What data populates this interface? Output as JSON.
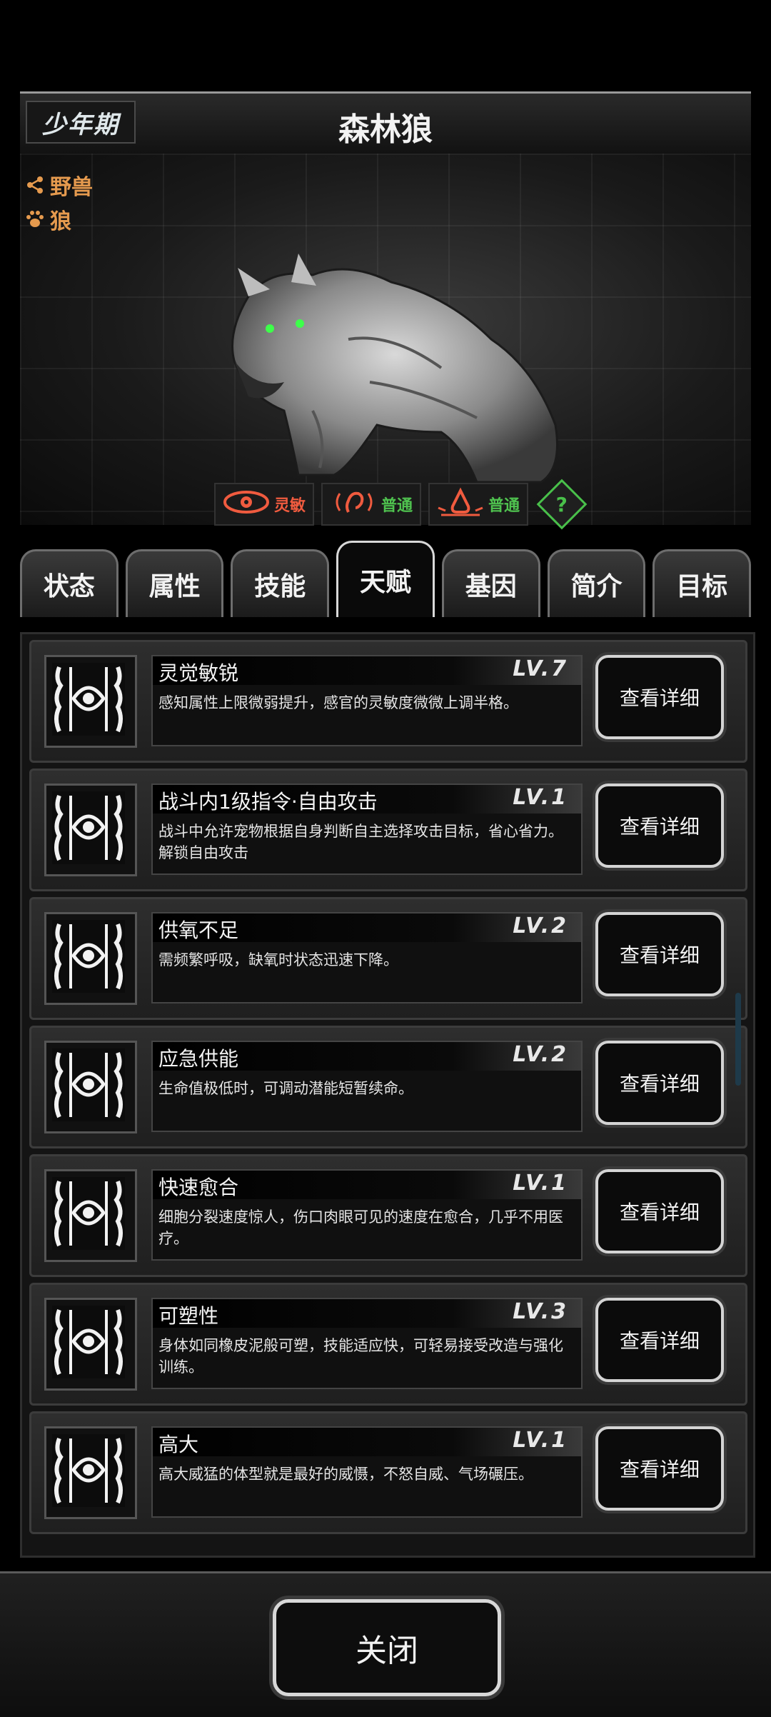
{
  "header": {
    "stage": "少年期",
    "title": "森林狼"
  },
  "tags": [
    {
      "icon": "share-icon",
      "label": "野兽"
    },
    {
      "icon": "paw-icon",
      "label": "狼"
    }
  ],
  "senses": [
    {
      "icon": "eye-icon",
      "label": "灵敏",
      "color": "#f05b3f"
    },
    {
      "icon": "ear-icon",
      "label": "普通",
      "color": "#4fc24f"
    },
    {
      "icon": "nose-icon",
      "label": "普通",
      "color": "#4fc24f"
    }
  ],
  "help_label": "?",
  "tabs": [
    "状态",
    "属性",
    "技能",
    "天赋",
    "基因",
    "简介",
    "目标"
  ],
  "active_tab": "天赋",
  "talents": [
    {
      "name": "灵觉敏锐",
      "level": "LV.7",
      "desc": "感知属性上限微弱提升，感官的灵敏度微微上调半格。",
      "button": "查看详细"
    },
    {
      "name": "战斗内1级指令·自由攻击",
      "level": "LV.1",
      "desc": "战斗中允许宠物根据自身判断自主选择攻击目标，省心省力。解锁自由攻击",
      "button": "查看详细"
    },
    {
      "name": "供氧不足",
      "level": "LV.2",
      "desc": "需频繁呼吸，缺氧时状态迅速下降。",
      "button": "查看详细"
    },
    {
      "name": "应急供能",
      "level": "LV.2",
      "desc": "生命值极低时，可调动潜能短暂续命。",
      "button": "查看详细"
    },
    {
      "name": "快速愈合",
      "level": "LV.1",
      "desc": "细胞分裂速度惊人，伤口肉眼可见的速度在愈合，几乎不用医疗。",
      "button": "查看详细"
    },
    {
      "name": "可塑性",
      "level": "LV.3",
      "desc": "身体如同橡皮泥般可塑，技能适应快，可轻易接受改造与强化训练。",
      "button": "查看详细"
    },
    {
      "name": "高大",
      "level": "LV.1",
      "desc": "高大威猛的体型就是最好的威慑，不怒自威、气场碾压。",
      "button": "查看详细"
    }
  ],
  "close_label": "关闭"
}
